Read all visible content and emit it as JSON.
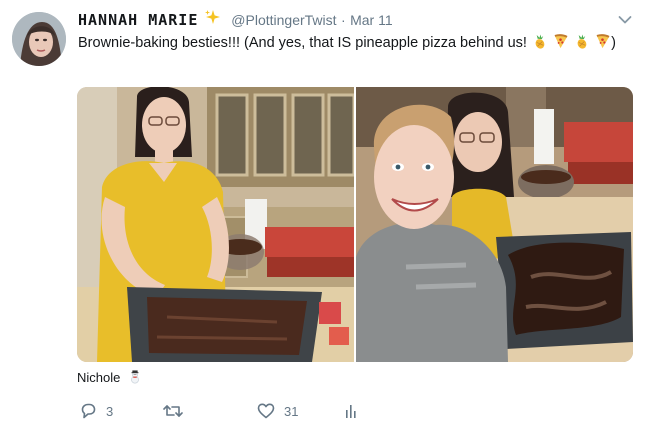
{
  "tweet": {
    "display_name": "HANNAH MARIE",
    "handle": "@PlottingerTwist",
    "separator": "·",
    "date": "Mar 11",
    "text": "Brownie-baking besties!!! (And yes, that IS pineapple pizza behind us!",
    "text_close": ")",
    "tagged_user": "Nichole",
    "reply_count": "3",
    "retweet_count": "",
    "like_count": "31"
  },
  "icons": {
    "sparkle": "sparkles-emoji",
    "pineapple": "pineapple-emoji",
    "pizza": "pizza-emoji",
    "tag": "snowman-emoji",
    "menu": "chevron-down-icon",
    "reply": "reply-icon",
    "retweet": "retweet-icon",
    "like": "heart-icon",
    "analytics": "analytics-icon"
  },
  "colors": {
    "text": "#14171a",
    "secondary": "#657786",
    "sparkle": "#f5c323"
  }
}
